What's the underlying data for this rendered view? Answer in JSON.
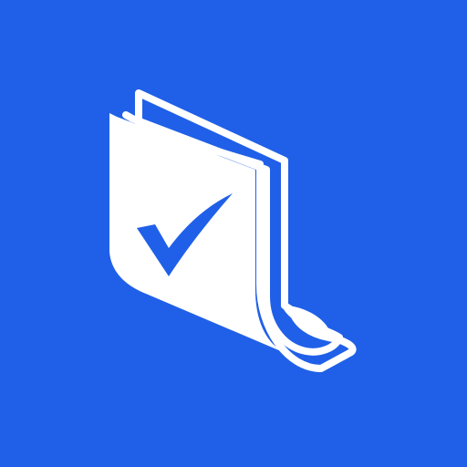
{
  "app_icon": {
    "icon": "document-check-icon",
    "colors": {
      "background": "#2060E8",
      "foreground": "#FFFFFF"
    }
  }
}
